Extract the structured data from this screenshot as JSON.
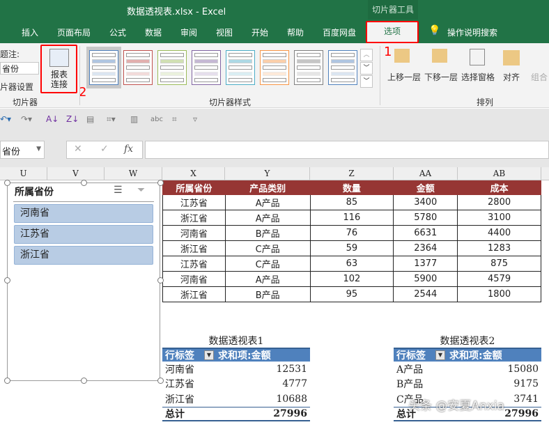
{
  "title": "数据透视表.xlsx  -  Excel",
  "context_tab": "切片器工具",
  "tabs": [
    "插入",
    "页面布局",
    "公式",
    "数据",
    "审阅",
    "视图",
    "开始",
    "帮助",
    "百度网盘",
    "选项"
  ],
  "active_tab": "选项",
  "tell_me": "操作说明搜索",
  "ribbon": {
    "caption_label": "题注:",
    "caption_value": "省份",
    "slicer_settings": "片器设置",
    "slicer_group": "切片器",
    "report_conn": [
      "报表",
      "连接"
    ],
    "styles_group": "切片器样式",
    "style_colors": [
      "#4f81bd",
      "#c0504d",
      "#9bbb59",
      "#8064a2",
      "#4bacc6",
      "#f79646",
      "#7f7f7f",
      "#4f81bd"
    ],
    "bring_forward": "上移一层",
    "send_backward": "下移一层",
    "selection_pane": "选择窗格",
    "align": "对齐",
    "group": "组合",
    "arrange_group": "排列",
    "annotations": [
      "1",
      "2"
    ]
  },
  "name_box": "省份",
  "formula_icons": [
    "cancel-icon",
    "enter-icon",
    "fx-icon"
  ],
  "fx": "fx",
  "columns": [
    "U",
    "V",
    "W",
    "X",
    "Y",
    "Z",
    "AA",
    "AB"
  ],
  "source_table": {
    "headers": [
      "所属省份",
      "产品类别",
      "数量",
      "金额",
      "成本"
    ],
    "rows": [
      [
        "江苏省",
        "A产品",
        "85",
        "3400",
        "2800"
      ],
      [
        "浙江省",
        "A产品",
        "116",
        "5780",
        "3100"
      ],
      [
        "河南省",
        "B产品",
        "76",
        "6631",
        "4400"
      ],
      [
        "浙江省",
        "C产品",
        "59",
        "2364",
        "1283"
      ],
      [
        "江苏省",
        "C产品",
        "63",
        "1377",
        "875"
      ],
      [
        "河南省",
        "A产品",
        "102",
        "5900",
        "4579"
      ],
      [
        "浙江省",
        "B产品",
        "95",
        "2544",
        "1800"
      ]
    ],
    "header_color": "#963634"
  },
  "slicer": {
    "title": "所属省份",
    "items": [
      "河南省",
      "江苏省",
      "浙江省"
    ]
  },
  "pivot1": {
    "title": "数据透视表1",
    "row_label": "行标签",
    "value_label": "求和项:金额",
    "rows": [
      [
        "河南省",
        "12531"
      ],
      [
        "江苏省",
        "4777"
      ],
      [
        "浙江省",
        "10688"
      ]
    ],
    "total_label": "总计",
    "total": "27996"
  },
  "pivot2": {
    "title": "数据透视表2",
    "row_label": "行标签",
    "value_label": "求和项:金额",
    "rows": [
      [
        "A产品",
        "15080"
      ],
      [
        "B产品",
        "9175"
      ],
      [
        "C产品",
        "3741"
      ]
    ],
    "total_label": "总计",
    "total": "27996"
  },
  "watermark": "头条 @安夏Anxia"
}
